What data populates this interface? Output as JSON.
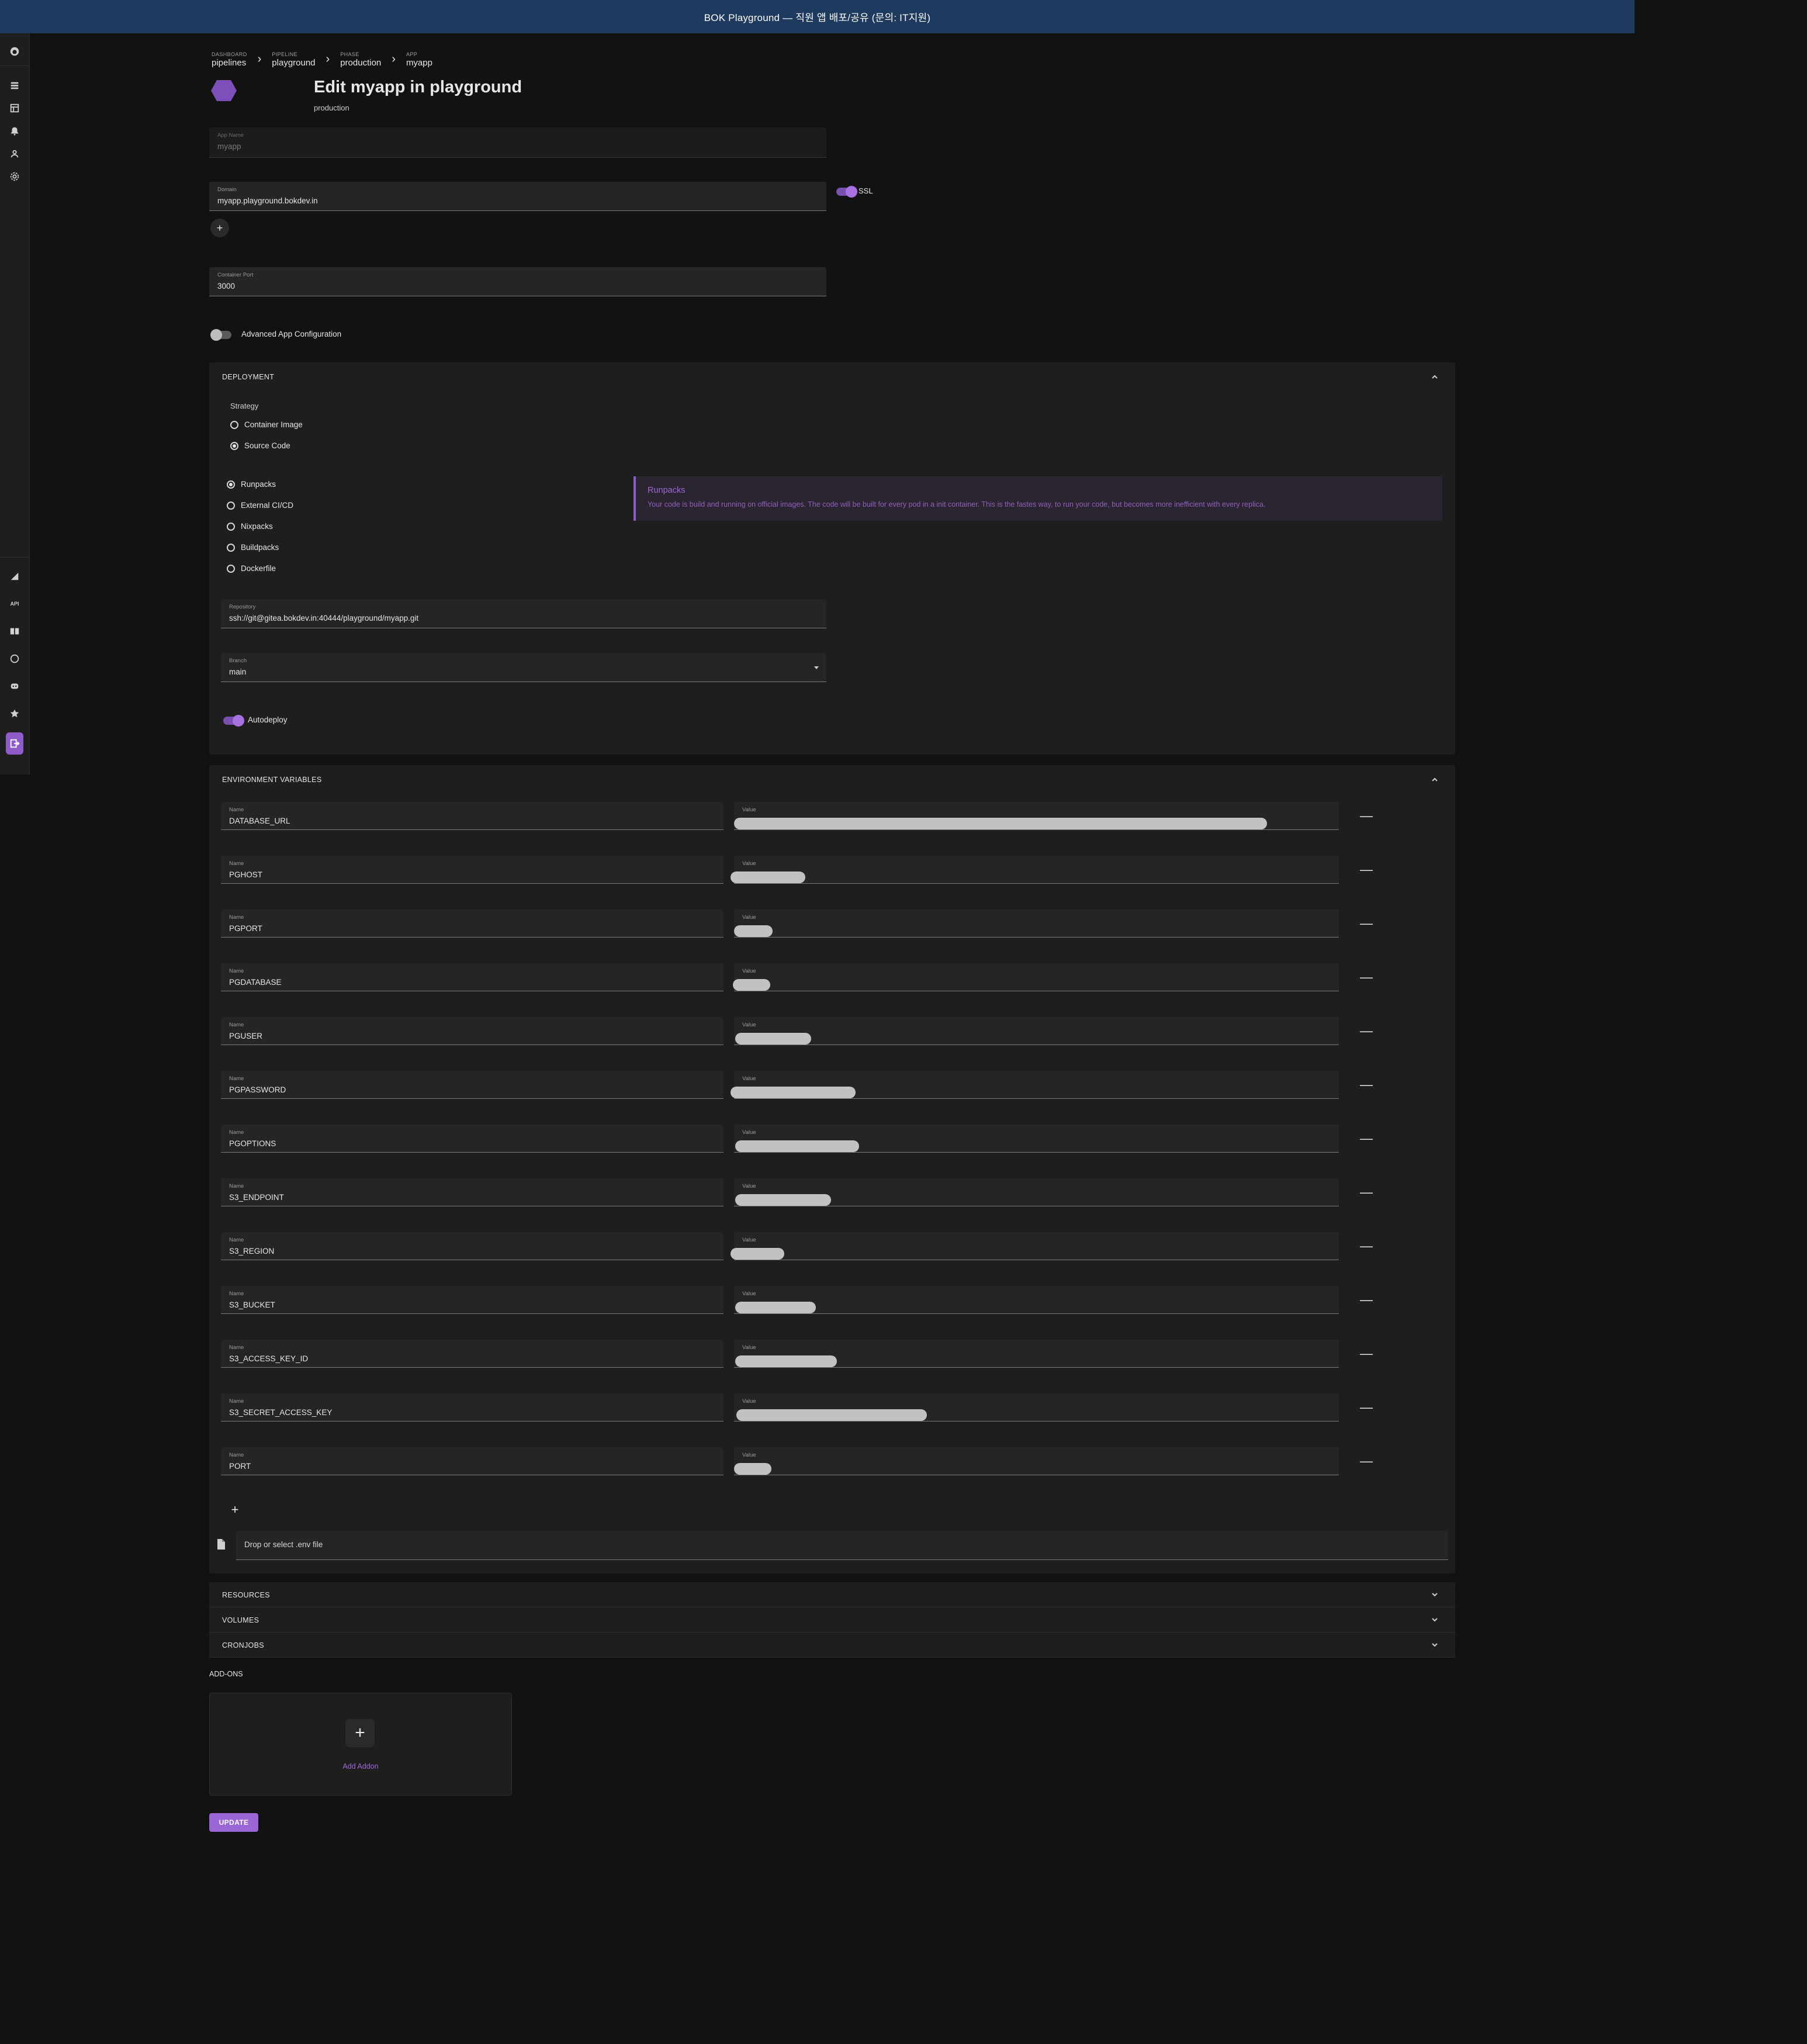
{
  "window": {
    "title": "BOK Playground — 직원 앱 배포/공유 (문의: IT지원)"
  },
  "sidebar": {
    "items": [
      {
        "icon": "logo-icon"
      },
      {
        "icon": "pipelines-icon"
      },
      {
        "icon": "apps-list-icon"
      },
      {
        "icon": "notifications-icon"
      },
      {
        "icon": "user-icon"
      },
      {
        "icon": "settings-icon"
      }
    ],
    "bottom_items": [
      {
        "icon": "theme-icon"
      },
      {
        "icon": "api-icon",
        "label": "API"
      },
      {
        "icon": "docs-icon"
      },
      {
        "icon": "github-icon"
      },
      {
        "icon": "discord-icon"
      },
      {
        "icon": "star-icon"
      },
      {
        "icon": "logout-icon"
      }
    ]
  },
  "breadcrumb": [
    {
      "label": "DASHBOARD",
      "value": "pipelines"
    },
    {
      "label": "PIPELINE",
      "value": "playground"
    },
    {
      "label": "PHASE",
      "value": "production"
    },
    {
      "label": "APP",
      "value": "myapp"
    }
  ],
  "header": {
    "title": "Edit myapp in playground",
    "subtitle": "production"
  },
  "form": {
    "app_name": {
      "label": "App Name",
      "value": "myapp"
    },
    "domain": {
      "label": "Domain",
      "value": "myapp.playground.bokdev.in"
    },
    "ssl_label": "SSL",
    "ssl_enabled": true,
    "add_domain_label": "+",
    "container_port": {
      "label": "Container Port",
      "value": "3000"
    },
    "advanced_label": "Advanced App Configuration",
    "advanced_enabled": false
  },
  "deployment": {
    "title": "DEPLOYMENT",
    "strategy_label": "Strategy",
    "strategies": [
      {
        "label": "Container Image",
        "checked": false
      },
      {
        "label": "Source Code",
        "checked": true
      }
    ],
    "build_methods": [
      {
        "label": "Runpacks",
        "checked": true
      },
      {
        "label": "External CI/CD",
        "checked": false
      },
      {
        "label": "Nixpacks",
        "checked": false
      },
      {
        "label": "Buildpacks",
        "checked": false
      },
      {
        "label": "Dockerfile",
        "checked": false
      }
    ],
    "info": {
      "title": "Runpacks",
      "text": "Your code is build and running on official images. The code will be built for every pod in a init container. This is the fastes way, to run your code, but becomes more inefficient with every replica."
    },
    "repository": {
      "label": "Repository",
      "value": "ssh://git@gitea.bokdev.in:40444/playground/myapp.git"
    },
    "branch": {
      "label": "Branch",
      "value": "main"
    },
    "autodeploy_label": "Autodeploy",
    "autodeploy_enabled": true
  },
  "env": {
    "title": "ENVIRONMENT VARIABLES",
    "name_label": "Name",
    "value_label": "Value",
    "vars": [
      {
        "name": "DATABASE_URL"
      },
      {
        "name": "PGHOST"
      },
      {
        "name": "PGPORT"
      },
      {
        "name": "PGDATABASE"
      },
      {
        "name": "PGUSER"
      },
      {
        "name": "PGPASSWORD"
      },
      {
        "name": "PGOPTIONS"
      },
      {
        "name": "S3_ENDPOINT"
      },
      {
        "name": "S3_REGION"
      },
      {
        "name": "S3_BUCKET"
      },
      {
        "name": "S3_ACCESS_KEY_ID"
      },
      {
        "name": "S3_SECRET_ACCESS_KEY"
      },
      {
        "name": "PORT"
      }
    ],
    "add_label": "+",
    "remove_label": "—",
    "dropzone": "Drop or select .env file"
  },
  "sections": [
    {
      "title": "RESOURCES"
    },
    {
      "title": "VOLUMES"
    },
    {
      "title": "CRONJOBS"
    }
  ],
  "addons": {
    "title": "ADD-ONS",
    "add_label": "Add Addon"
  },
  "actions": {
    "update_label": "UPDATE"
  },
  "colors": {
    "accent": "#9b66d6",
    "topbar": "#1e3a5f",
    "background": "#121212",
    "panel": "#1e1e1e"
  }
}
